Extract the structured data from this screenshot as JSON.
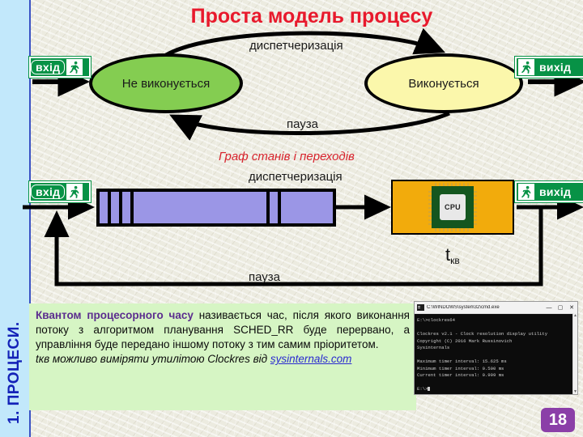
{
  "slide": {
    "title": "Проста модель процесу",
    "page_number": "18",
    "sidebar_label": "1. ПРОЦЕСИ."
  },
  "state_graph": {
    "subtitle": "Граф станів і переходів",
    "state_not_running": "Не виконується",
    "state_running": "Виконується",
    "transition_top": "диспетчеризація",
    "transition_bottom": "пауза",
    "entry_sign": "вхід",
    "exit_sign": "вихід"
  },
  "queue_diagram": {
    "entry_sign": "вхід",
    "exit_sign": "вихід",
    "dispatch_label": "диспетчеризація",
    "pause_label": "пауза",
    "cpu_label": "CPU",
    "quantum_symbol": "t",
    "quantum_subscript": "кв",
    "queue_cells": [
      14,
      14,
      14,
      168,
      14,
      22
    ]
  },
  "definition": {
    "term": "Квантом процесорного часу",
    "body": " називається час, після якого виконання потоку з алгоритмом планування SCHED_RR буде перервано, а управління буде передано іншому потоку з тим самим пріоритетом.",
    "note": "tкв можливо виміряти утилітою Clockres від",
    "link": "sysinternals.com"
  },
  "console": {
    "title": "C:\\WINDOWS\\system32\\cmd.exe",
    "minimize": "—",
    "maximize": "▢",
    "close": "✕",
    "scroll_up": "▲",
    "scroll_down": "▼",
    "lines": [
      "E:\\>clockres64",
      "",
      "Clockres v2.1 - Clock resolution display utility",
      "Copyright (C) 2016 Mark Russinovich",
      "Sysinternals",
      "",
      "Maximum timer interval: 15.625 ms",
      "Minimum timer interval: 0.500 ms",
      "Current timer interval: 0.999 ms",
      "",
      "E:\\>"
    ]
  },
  "colors": {
    "title_red": "#e8192c",
    "sidebar_blue": "#1422b8",
    "state_green": "#84cd51",
    "state_yellow": "#fbf7ab",
    "queue_purple": "#9b96e6",
    "cpu_orange": "#f2ab0c",
    "definition_green": "#d6f5c4",
    "badge_purple": "#8b3fa8",
    "sign_green": "#079246"
  }
}
